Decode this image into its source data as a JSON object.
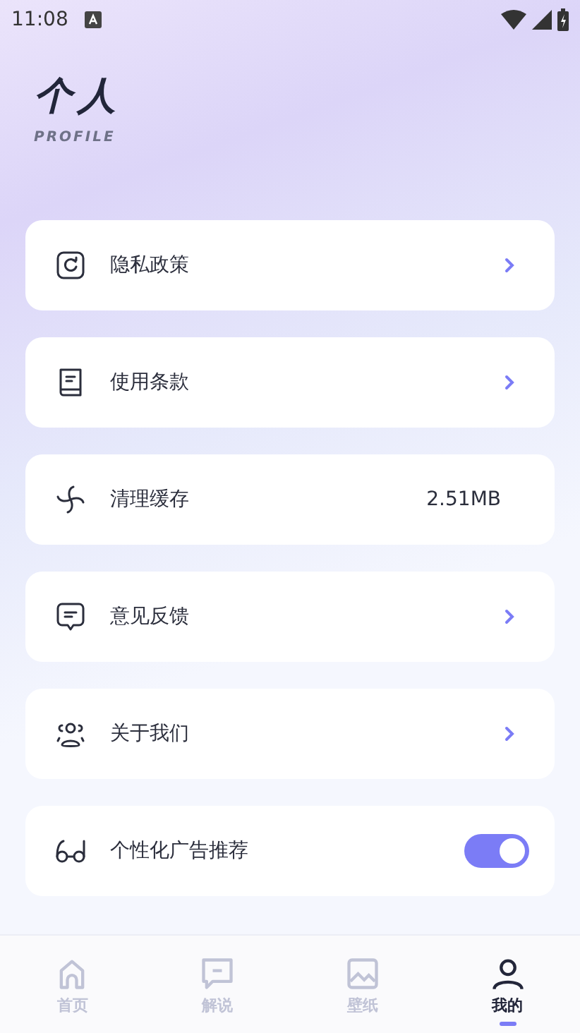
{
  "status_bar": {
    "time": "11:08"
  },
  "header": {
    "title": "个人",
    "subtitle": "PROFILE"
  },
  "settings": [
    {
      "kind": "link",
      "label": "隐私政策"
    },
    {
      "kind": "link",
      "label": "使用条款"
    },
    {
      "kind": "value",
      "label": "清理缓存",
      "value": "2.51MB"
    },
    {
      "kind": "link",
      "label": "意见反馈"
    },
    {
      "kind": "link",
      "label": "关于我们"
    },
    {
      "kind": "toggle",
      "label": "个性化广告推荐",
      "on": true
    }
  ],
  "tabs": [
    {
      "label": "首页",
      "selected": false
    },
    {
      "label": "解说",
      "selected": false
    },
    {
      "label": "壁纸",
      "selected": false
    },
    {
      "label": "我的",
      "selected": true
    }
  ]
}
